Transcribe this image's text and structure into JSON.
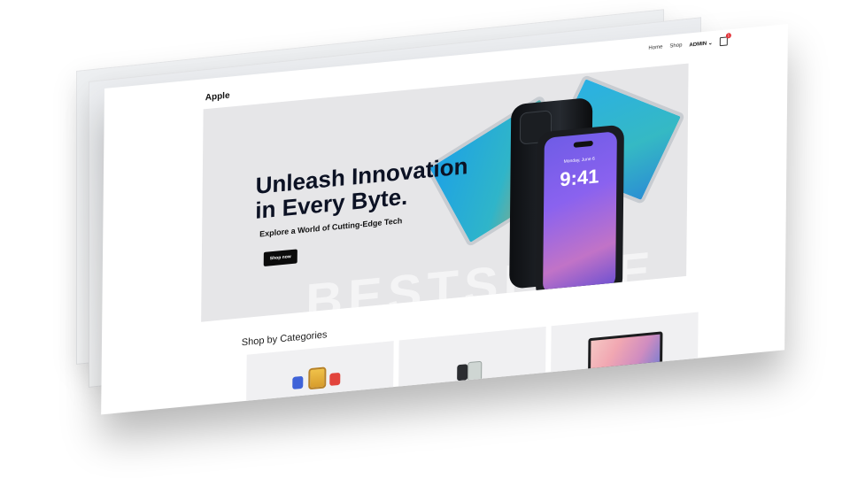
{
  "header": {
    "logo": "Apple",
    "nav": {
      "home": "Home",
      "shop": "Shop",
      "admin": "ADMIN",
      "cart_count": "1"
    }
  },
  "hero": {
    "title_line1": "Unleash Innovation",
    "title_line2": "in Every Byte.",
    "subtitle": "Explore a World of Cutting-Edge Tech",
    "button": "Shop now",
    "watermark": "BESTSELLE",
    "phone_time": "9:41",
    "phone_date": "Monday, June 6"
  },
  "categories": {
    "title": "Shop by Categories"
  },
  "icons": {
    "cart": "cart-icon",
    "admin_caret": "chevron-down-icon"
  }
}
